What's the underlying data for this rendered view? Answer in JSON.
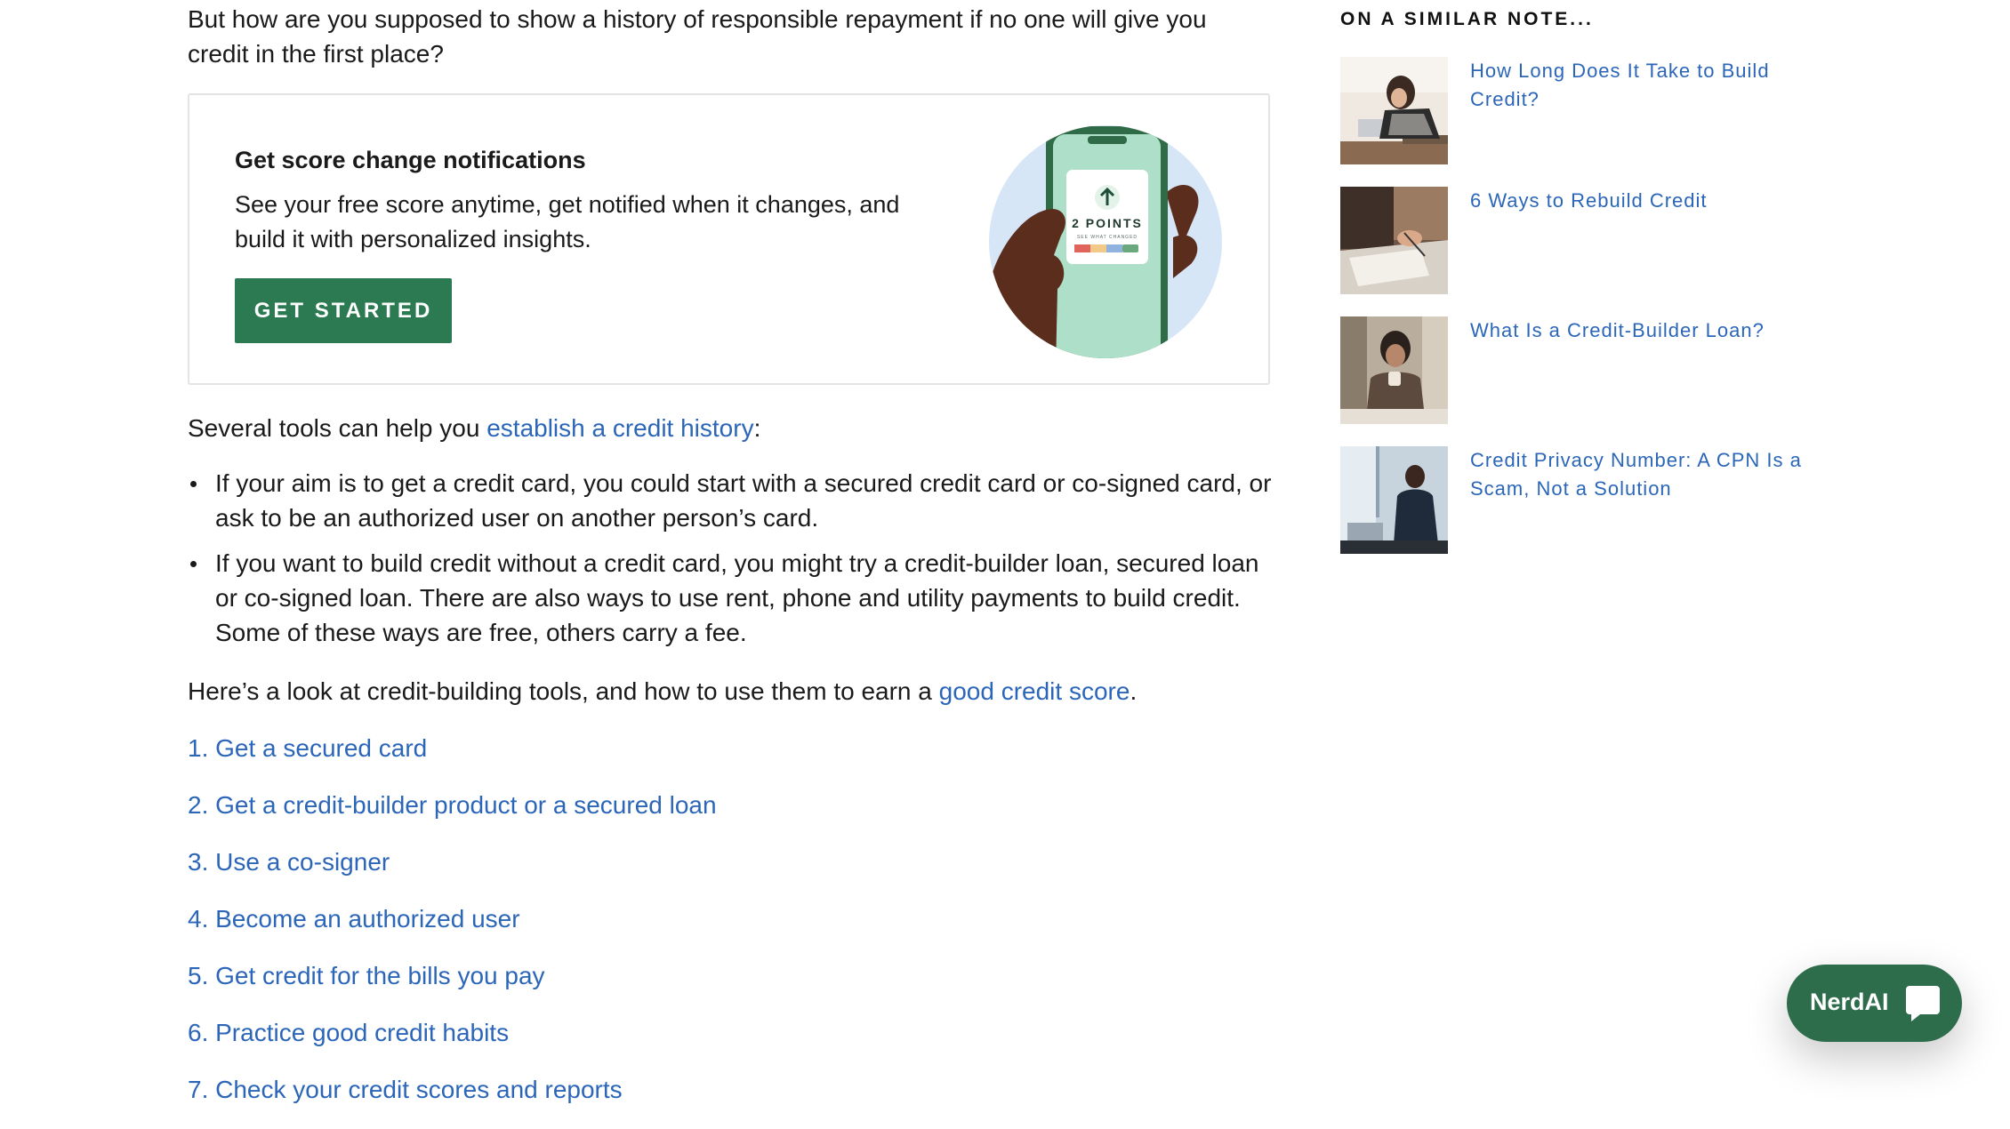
{
  "article": {
    "intro": "But how are you supposed to show a history of responsible repayment if no one will give you credit in the first place?",
    "promo": {
      "title": "Get score change notifications",
      "text": "See your free score anytime, get notified when it changes, and build it with personalized insights.",
      "button_label": "GET STARTED",
      "phone_points": "2 POINTS",
      "phone_caption": "SEE WHAT CHANGED"
    },
    "tools_para": {
      "before": "Several tools can help you ",
      "link": "establish a credit history",
      "after": ":"
    },
    "bullets": [
      "If your aim is to get a credit card, you could start with a secured credit card or co-signed card, or ask to be an authorized user on another person’s card.",
      "If you want to build credit without a credit card, you might try a credit-builder loan, secured loan or co-signed loan. There are also ways to use rent, phone and utility payments to build credit. Some of these ways are free, others carry a fee."
    ],
    "look_para": {
      "before": "Here’s a look at credit-building tools, and how to use them to earn a ",
      "link": "good credit score",
      "after": "."
    },
    "toc": [
      "1. Get a secured card",
      "2. Get a credit-builder product or a secured loan",
      "3. Use a co-signer",
      "4. Become an authorized user",
      "5. Get credit for the bills you pay",
      "6. Practice good credit habits",
      "7. Check your credit scores and reports"
    ]
  },
  "sidebar": {
    "heading": "ON A SIMILAR NOTE...",
    "items": [
      {
        "title": "How Long Does It Take to Build Credit?"
      },
      {
        "title": "6 Ways to Rebuild Credit"
      },
      {
        "title": "What Is a Credit-Builder Loan?"
      },
      {
        "title": "Credit Privacy Number: A CPN Is a Scam, Not a Solution"
      }
    ]
  },
  "nerdai": {
    "label": "NerdAI",
    "icon": "chat-bubble-icon"
  },
  "colors": {
    "link": "#2b66b8",
    "brand_green": "#2b7a52",
    "nerdai_green": "#2e6d4c"
  }
}
